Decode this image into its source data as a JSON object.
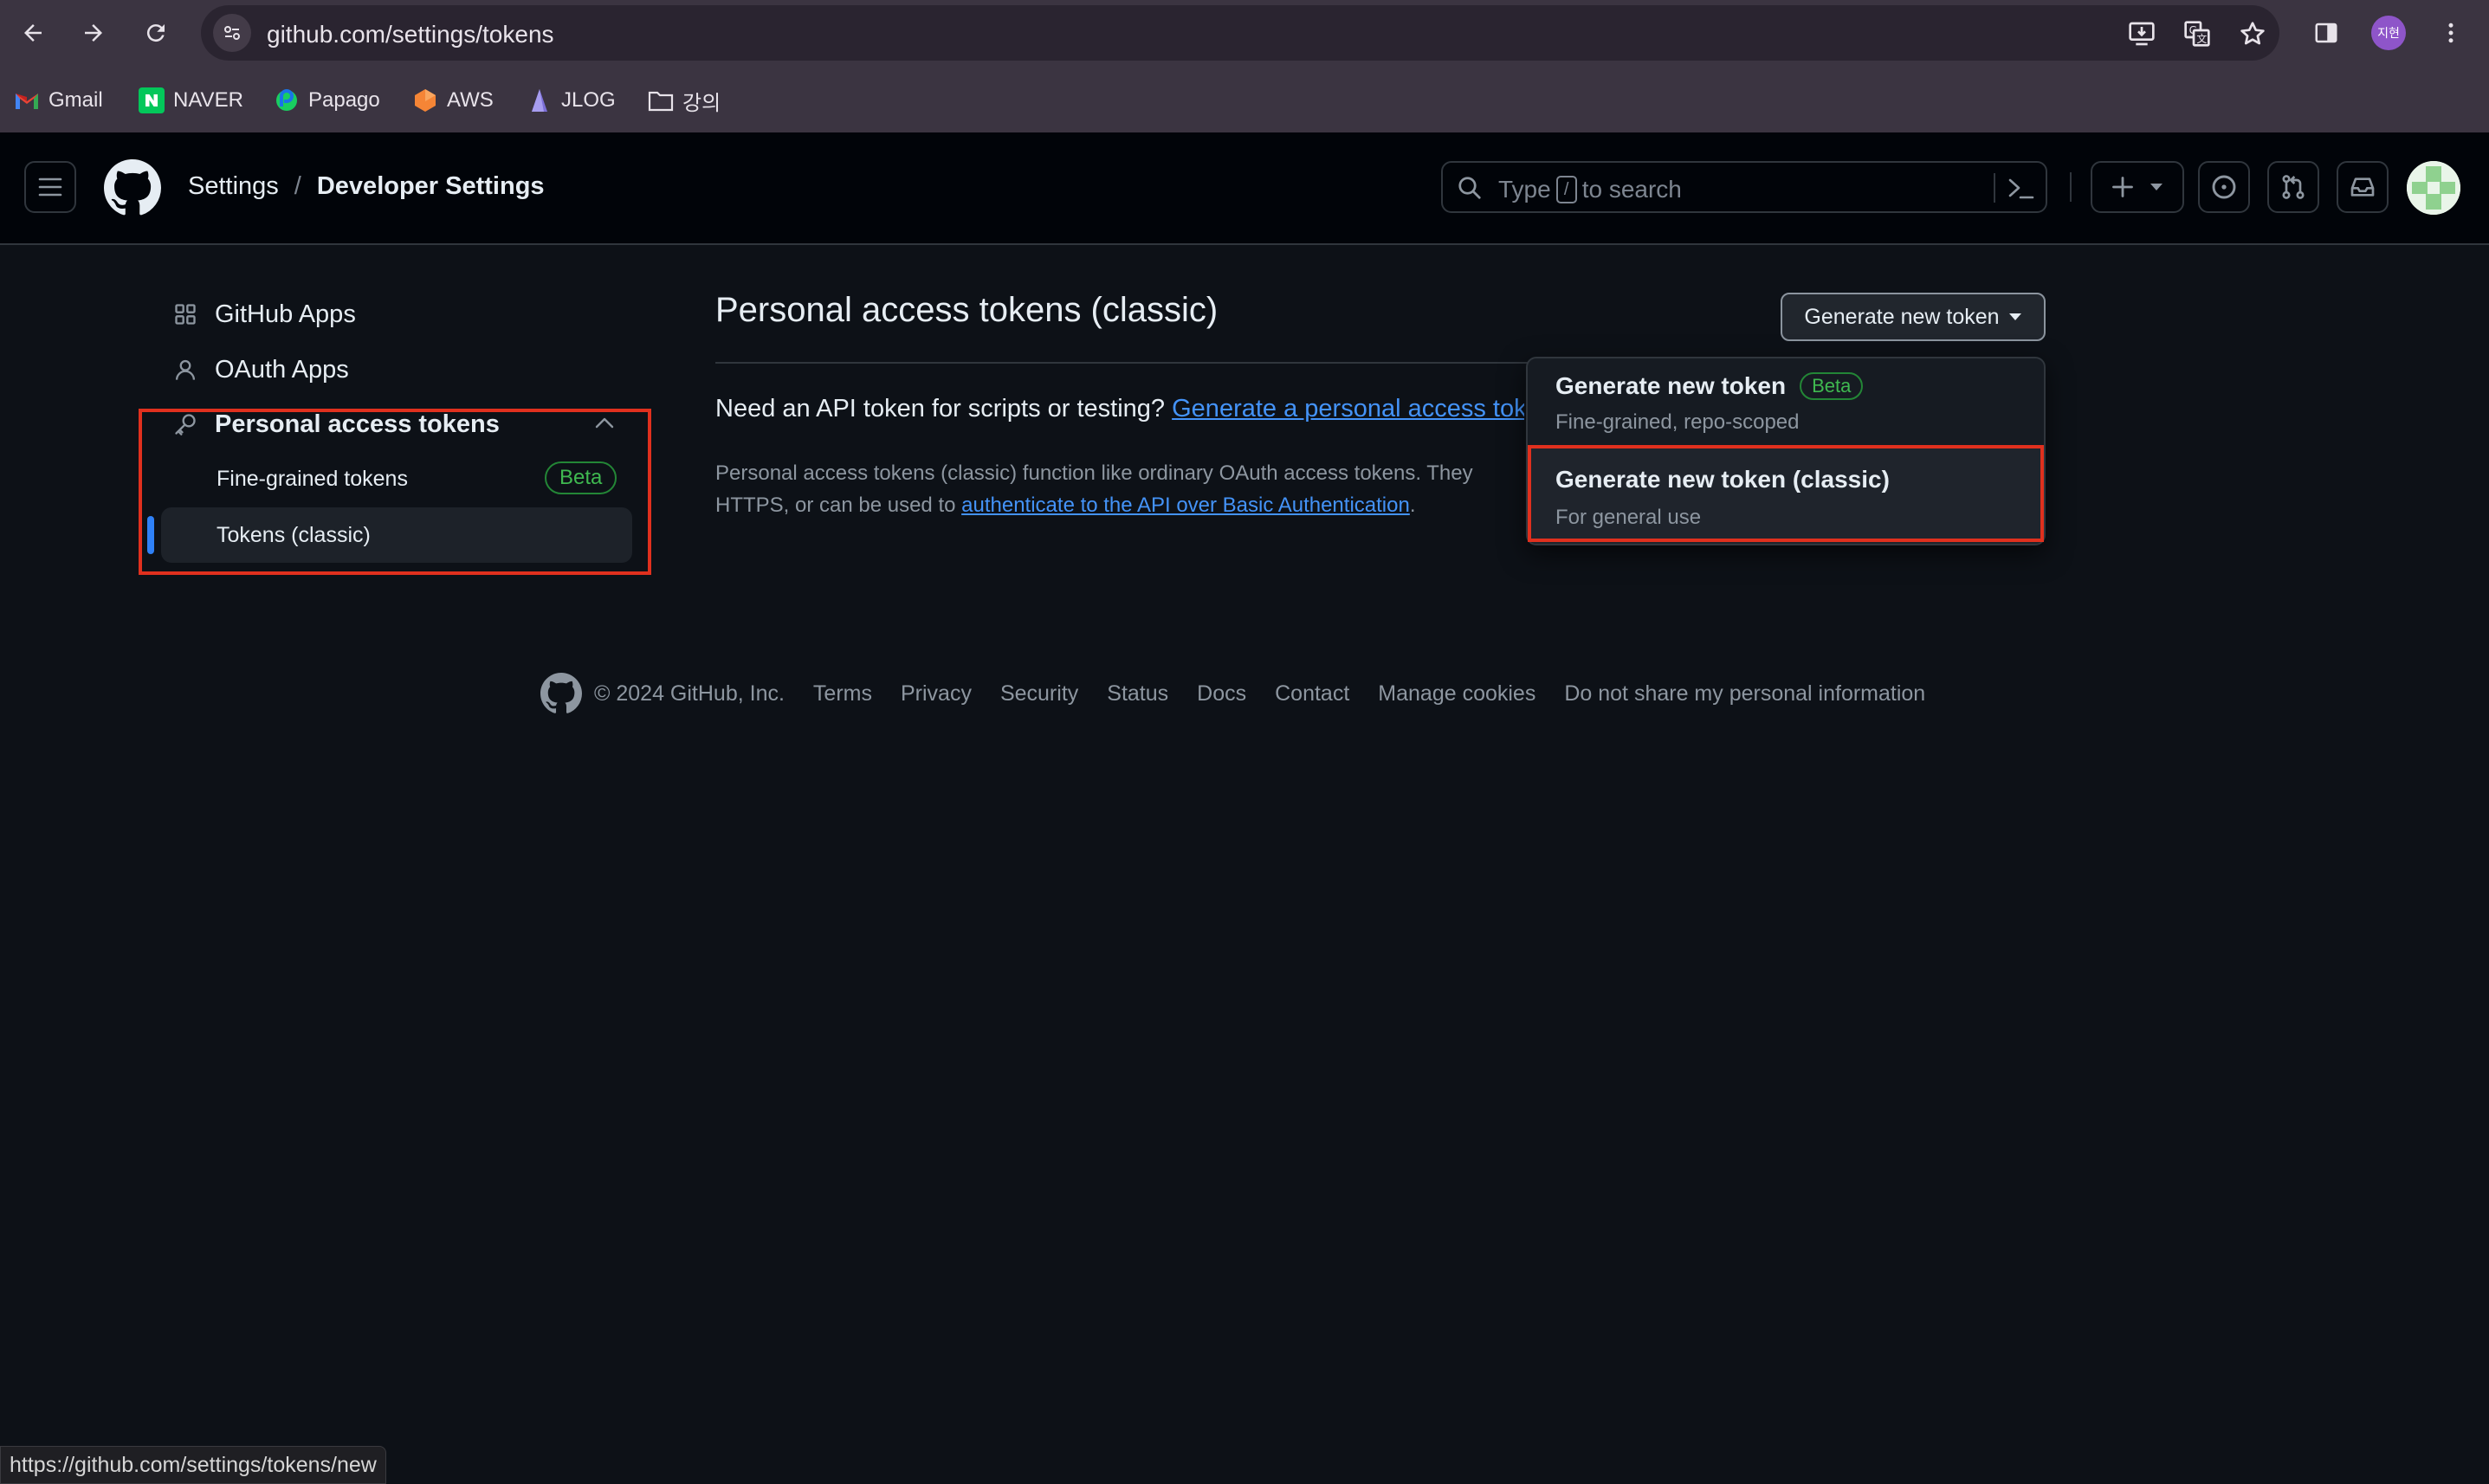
{
  "browser": {
    "url": "github.com/settings/tokens",
    "profile_initials": "지현",
    "bookmarks": [
      {
        "label": "Gmail",
        "icon": "gmail-icon"
      },
      {
        "label": "NAVER",
        "icon": "naver-icon"
      },
      {
        "label": "Papago",
        "icon": "papago-icon"
      },
      {
        "label": "AWS",
        "icon": "aws-icon"
      },
      {
        "label": "JLOG",
        "icon": "jlog-icon"
      },
      {
        "label": "강의",
        "icon": "folder-icon"
      }
    ],
    "status_url": "https://github.com/settings/tokens/new"
  },
  "header": {
    "breadcrumb_settings": "Settings",
    "breadcrumb_sep": "/",
    "breadcrumb_current": "Developer Settings",
    "search_placeholder_pre": "Type",
    "search_placeholder_key": "/",
    "search_placeholder_post": "to search"
  },
  "sidebar": {
    "github_apps": "GitHub Apps",
    "oauth_apps": "OAuth Apps",
    "pat": "Personal access tokens",
    "fine_grained": "Fine-grained tokens",
    "fine_grained_badge": "Beta",
    "classic": "Tokens (classic)"
  },
  "main": {
    "title": "Personal access tokens (classic)",
    "need_text": "Need an API token for scripts or testing?",
    "need_link": "Generate a personal access tok",
    "desc_line1": "Personal access tokens (classic) function like ordinary OAuth access tokens. They",
    "desc_line2_pre": "HTTPS, or can be used to",
    "desc_line2_link": "authenticate to the API over Basic Authentication",
    "desc_line2_post": ".",
    "generate_button": "Generate new token"
  },
  "dropdown": {
    "item1_title": "Generate new token",
    "item1_badge": "Beta",
    "item1_sub": "Fine-grained, repo-scoped",
    "item2_title": "Generate new token (classic)",
    "item2_sub": "For general use"
  },
  "footer": {
    "copyright": "© 2024 GitHub, Inc.",
    "links": [
      "Terms",
      "Privacy",
      "Security",
      "Status",
      "Docs",
      "Contact",
      "Manage cookies",
      "Do not share my personal information"
    ]
  },
  "colors": {
    "page_bg": "#0d1117",
    "link": "#4493f8",
    "highlight_box": "#e0301e",
    "beta_green": "#3fb950",
    "active_indicator": "#2f81f7"
  }
}
